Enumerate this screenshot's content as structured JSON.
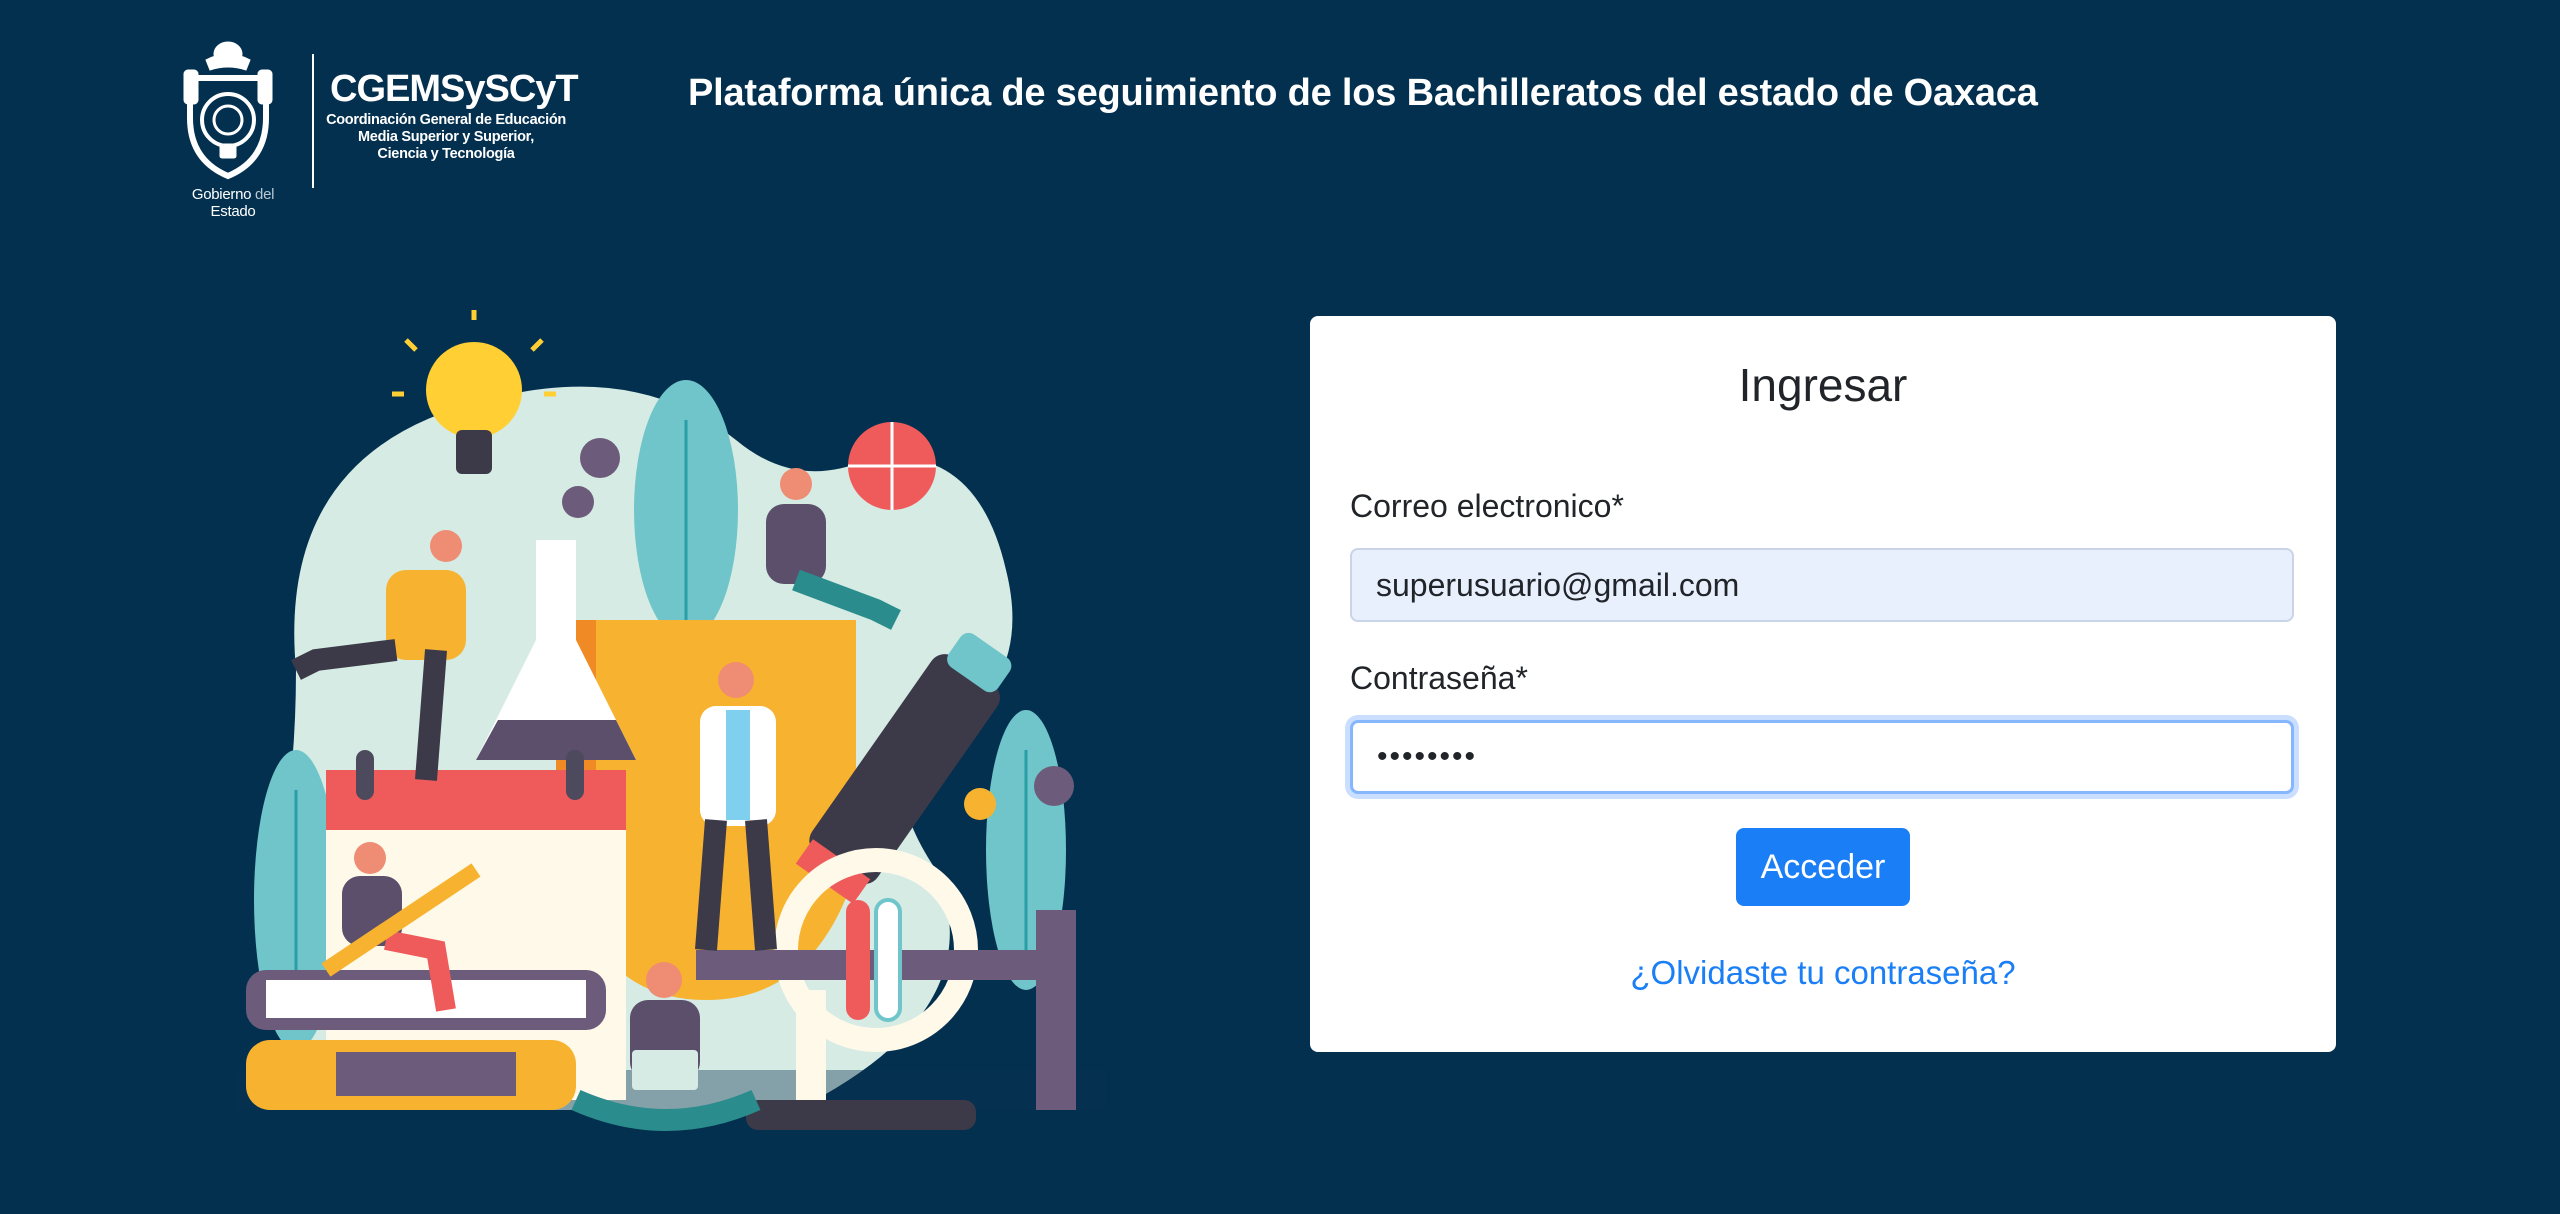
{
  "header": {
    "gobierno_prefix": "Gobierno",
    "gobierno_mid": "del",
    "gobierno_suffix": "Estado",
    "logo_acronym": "CGEMSySCyT",
    "logo_desc_1": "Coordinación General de Educación",
    "logo_desc_2": "Media Superior y Superior,",
    "logo_desc_3": "Ciencia y Tecnología",
    "platform_title": "Plataforma única de seguimiento de los Bachilleratos del estado de Oaxaca"
  },
  "login": {
    "title": "Ingresar",
    "email_label": "Correo electronico*",
    "email_value": "superusuario@gmail.com",
    "password_label": "Contraseña*",
    "password_value": "••••••••",
    "submit_label": "Acceder",
    "forgot_link": "¿Olvidaste tu contraseña?"
  },
  "colors": {
    "background": "#04304f",
    "primary": "#1a7ef6",
    "autofill": "#e8f0fe"
  },
  "icons": {
    "logo": "oaxaca-state-seal-icon",
    "illustration": "education-science-illustration"
  }
}
